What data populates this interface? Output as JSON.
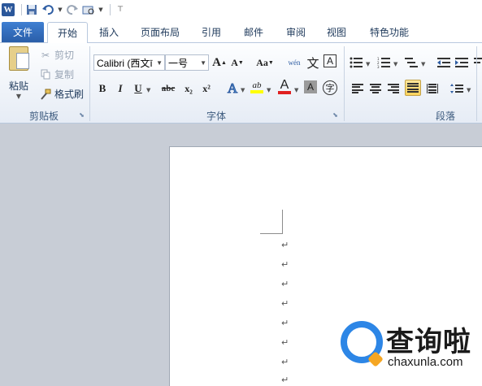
{
  "app": {
    "logo_letter": "W"
  },
  "qat": {
    "items": [
      "save-icon",
      "undo-icon",
      "redo-icon",
      "print-preview-icon",
      "customize-icon"
    ]
  },
  "tabs": [
    "文件",
    "开始",
    "插入",
    "页面布局",
    "引用",
    "邮件",
    "审阅",
    "视图",
    "特色功能"
  ],
  "clipboard": {
    "paste_label": "粘贴",
    "cut_label": "剪切",
    "copy_label": "复制",
    "format_painter_label": "格式刷",
    "group_label": "剪贴板"
  },
  "font": {
    "font_name": "Calibri (西文ī",
    "font_size": "一号",
    "grow_label": "A",
    "shrink_label": "A",
    "change_case_label": "Aa",
    "pinyin_label": "wén",
    "clear_label": "文",
    "border_label": "A",
    "bold_label": "B",
    "italic_label": "I",
    "underline_label": "U",
    "strike_label": "abc",
    "sub_label": "x₂",
    "sup_label": "x²",
    "effects_label": "A",
    "highlight_label": "ab",
    "color_label": "A",
    "shade_label": "A",
    "enclose_label": "字",
    "group_label": "字体"
  },
  "paragraph": {
    "group_label": "段落"
  },
  "document": {
    "para_mark": "↵"
  },
  "watermark": {
    "title": "查询啦",
    "url": "chaxunla.com"
  },
  "colors": {
    "accent": "#2b579a",
    "file_tab": "#2a5ea8",
    "highlight": "#ffd35a",
    "font_color": "#e02020",
    "doc_bg": "#c8cdd6"
  }
}
